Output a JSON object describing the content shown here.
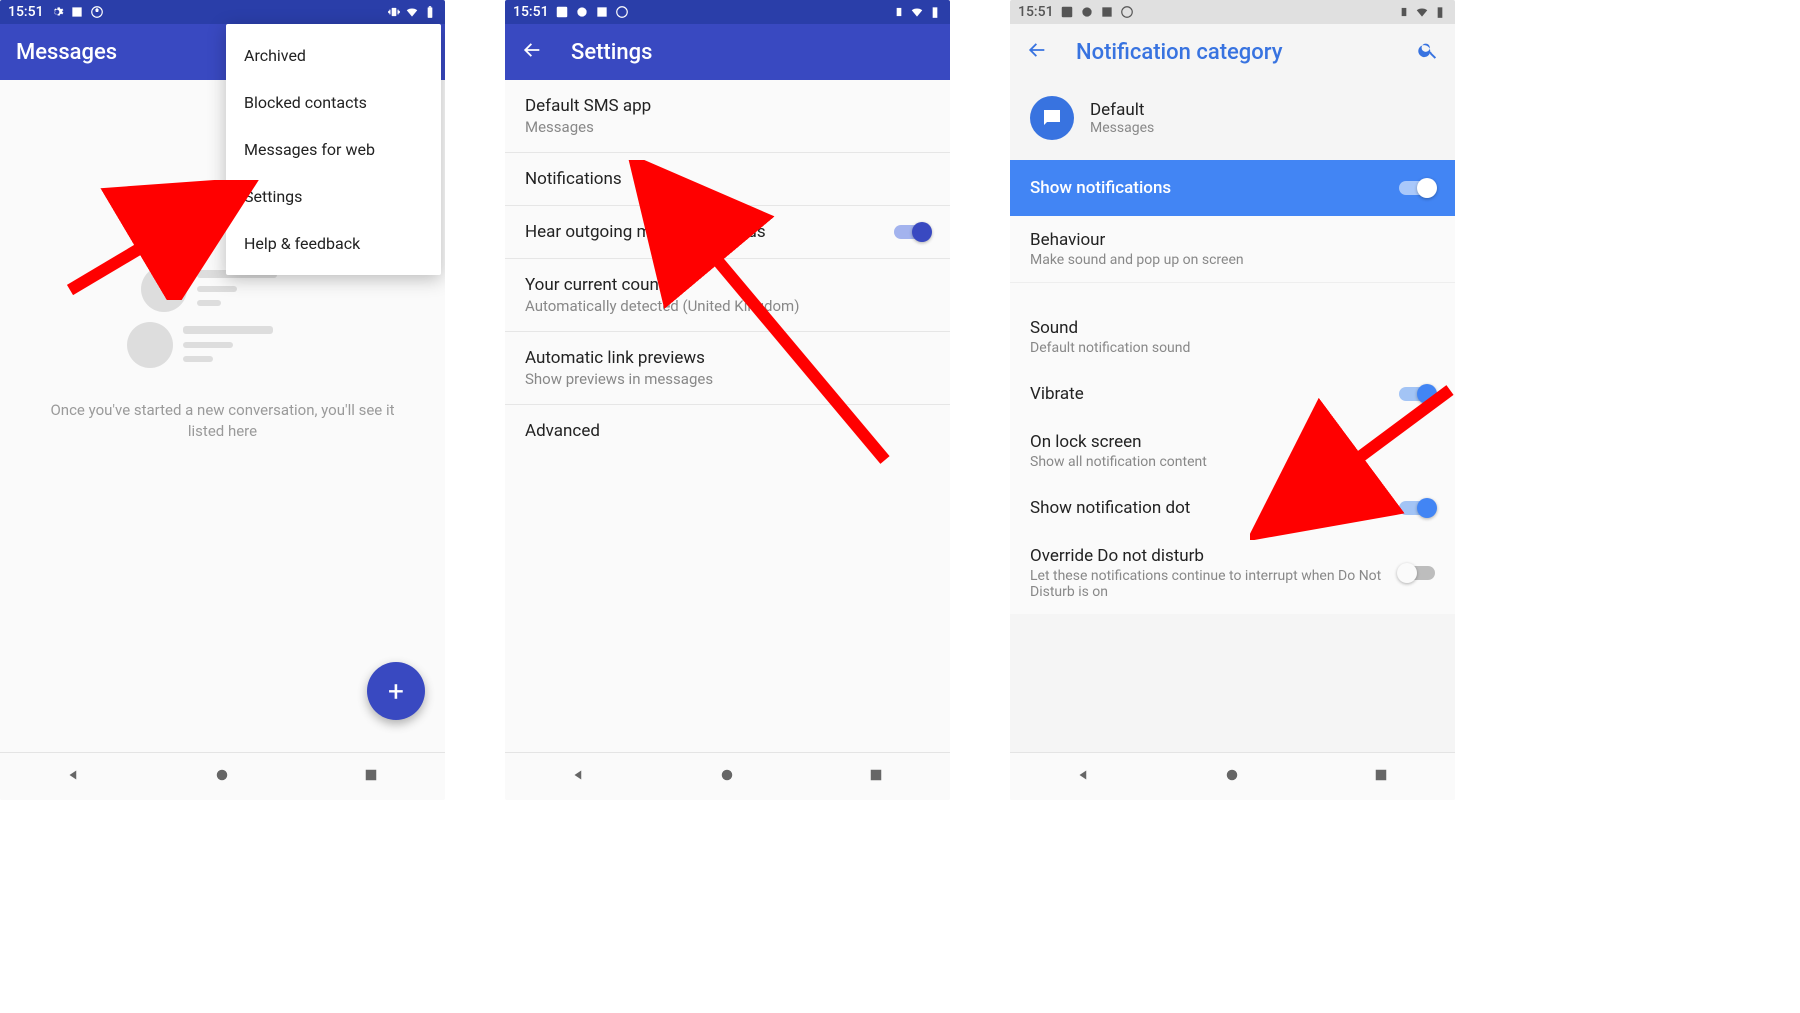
{
  "status": {
    "time": "15:51"
  },
  "screen1": {
    "title": "Messages",
    "menu": [
      "Archived",
      "Blocked contacts",
      "Messages for web",
      "Settings",
      "Help & feedback"
    ],
    "empty_text": "Once you've started a new conversation, you'll see it listed here"
  },
  "screen2": {
    "title": "Settings",
    "items": [
      {
        "title": "Default SMS app",
        "sub": "Messages"
      },
      {
        "title": "Notifications"
      },
      {
        "title": "Hear outgoing message sounds",
        "toggle": true
      },
      {
        "title": "Your current country",
        "sub": "Automatically detected (United Kingdom)"
      },
      {
        "title": "Automatic link previews",
        "sub": "Show previews in messages"
      },
      {
        "title": "Advanced"
      }
    ]
  },
  "screen3": {
    "title": "Notification category",
    "header": {
      "title": "Default",
      "sub": "Messages"
    },
    "show_notifications": "Show notifications",
    "items": [
      {
        "title": "Behaviour",
        "sub": "Make sound and pop up on screen"
      },
      {
        "group_gap": true
      },
      {
        "title": "Sound",
        "sub": "Default notification sound"
      },
      {
        "title": "Vibrate",
        "toggle": true
      },
      {
        "title": "On lock screen",
        "sub": "Show all notification content"
      },
      {
        "title": "Show notification dot",
        "toggle": true
      },
      {
        "title": "Override Do not disturb",
        "sub": "Let these notifications continue to interrupt when Do Not Disturb is on",
        "toggle_off": true
      }
    ]
  }
}
